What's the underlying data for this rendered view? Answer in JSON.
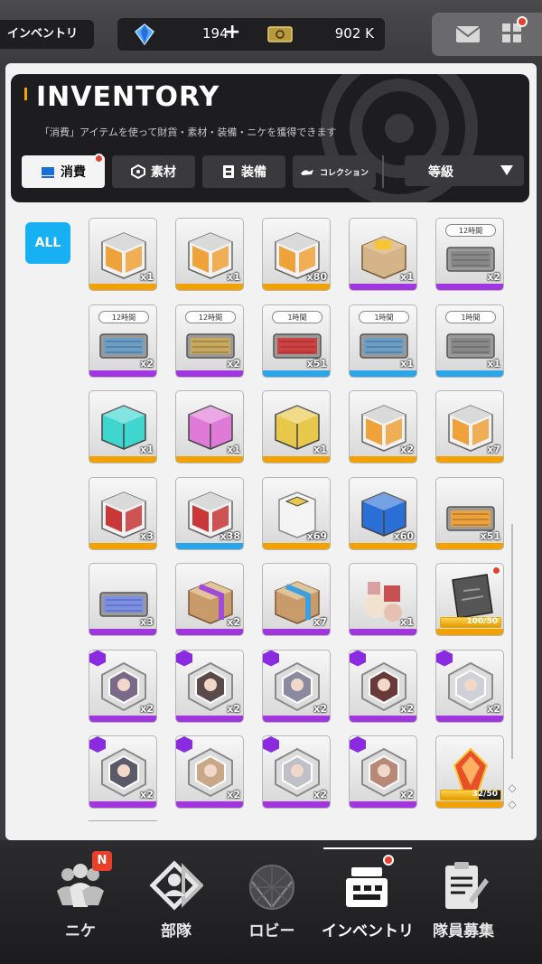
{
  "topbar": {
    "screen_label": "インベントリ",
    "gem_amount": "194",
    "plus": "+",
    "credit_amount": "902 K"
  },
  "header": {
    "title": "INVENTORY",
    "subtitle": "「消費」アイテムを使って財貨・素材・装備・ニケを獲得できます",
    "tabs": [
      {
        "label": "消費",
        "icon": "consumable-icon",
        "active": true
      },
      {
        "label": "素材",
        "icon": "material-icon",
        "active": false
      },
      {
        "label": "装備",
        "icon": "equipment-icon",
        "active": false
      },
      {
        "label": "コレクション",
        "icon": "collection-icon",
        "active": false
      }
    ],
    "sort_label": "等級"
  },
  "filter": {
    "all_label": "ALL"
  },
  "items": [
    {
      "name": "orange-box-item",
      "qty": "x1",
      "rarity": "#f2a200",
      "color": "#f0a23a"
    },
    {
      "name": "orange-box-item",
      "qty": "x1",
      "rarity": "#f2a200",
      "color": "#f0a23a"
    },
    {
      "name": "orange-box-item",
      "qty": "x80",
      "rarity": "#f2a200",
      "color": "#f0a23a"
    },
    {
      "name": "cardboard-box-item",
      "qty": "x1",
      "rarity": "#a335e0",
      "color": "#d6b48a"
    },
    {
      "name": "timed-case-item",
      "qty": "x2",
      "rarity": "#a335e0",
      "color": "#888888",
      "timer": "12時間"
    },
    {
      "name": "timed-case-item",
      "qty": "x2",
      "rarity": "#a335e0",
      "color": "#6aa0c8",
      "timer": "12時間"
    },
    {
      "name": "timed-case-item",
      "qty": "x2",
      "rarity": "#a335e0",
      "color": "#c8a85a",
      "timer": "12時間"
    },
    {
      "name": "timed-case-item",
      "qty": "x51",
      "rarity": "#2aa6e8",
      "color": "#d04040",
      "timer": "1時間"
    },
    {
      "name": "timed-case-item",
      "qty": "x1",
      "rarity": "#2aa6e8",
      "color": "#6aa0c8",
      "timer": "1時間"
    },
    {
      "name": "timed-case-item",
      "qty": "x1",
      "rarity": "#2aa6e8",
      "color": "#888888",
      "timer": "1時間"
    },
    {
      "name": "cyan-crate-item",
      "qty": "x1",
      "rarity": "#f2a200",
      "color": "#3fd6cf"
    },
    {
      "name": "pink-crate-item",
      "qty": "x1",
      "rarity": "#f2a200",
      "color": "#e07ad8"
    },
    {
      "name": "gold-crate-item",
      "qty": "x1",
      "rarity": "#f2a200",
      "color": "#e8c84a"
    },
    {
      "name": "orange-box-item",
      "qty": "x2",
      "rarity": "#f2a200",
      "color": "#f0a23a"
    },
    {
      "name": "orange-box-item",
      "qty": "x7",
      "rarity": "#f2a200",
      "color": "#f0a23a"
    },
    {
      "name": "red-box-item",
      "qty": "x3",
      "rarity": "#f2a200",
      "color": "#c83838"
    },
    {
      "name": "red-box-item",
      "qty": "x38",
      "rarity": "#2aa6e8",
      "color": "#c83838"
    },
    {
      "name": "white-container-item",
      "qty": "x69",
      "rarity": "#f2a200",
      "color": "#e8e8e8"
    },
    {
      "name": "supply-crate-item",
      "qty": "x60",
      "rarity": "#f2a200",
      "color": "#2a6fd6"
    },
    {
      "name": "colorful-case-item",
      "qty": "x51",
      "rarity": "#f2a200",
      "color": "#f0a23a"
    },
    {
      "name": "colorful-case-item",
      "qty": "x3",
      "rarity": "#a335e0",
      "color": "#7a8fe8"
    },
    {
      "name": "purple-package-item",
      "qty": "x2",
      "rarity": "#a335e0",
      "color": "#c99a6a"
    },
    {
      "name": "blue-package-item",
      "qty": "x7",
      "rarity": "#a335e0",
      "color": "#c99a6a"
    },
    {
      "name": "gift-pile-item",
      "qty": "x1",
      "rarity": "#a335e0",
      "color": "#c85050"
    },
    {
      "name": "collection-card-item",
      "qty": "",
      "rarity": "#f2a200",
      "color": "#555555",
      "bar": "100/50",
      "bar_pct": 100,
      "notif": true
    },
    {
      "name": "nikke-token-item",
      "qty": "x2",
      "rarity": "#a335e0",
      "color": "#7a6a8a",
      "badge": "#8a2be2"
    },
    {
      "name": "nikke-token-item",
      "qty": "x2",
      "rarity": "#a335e0",
      "color": "#5a4a4a",
      "badge": "#8a2be2"
    },
    {
      "name": "nikke-token-item",
      "qty": "x2",
      "rarity": "#a335e0",
      "color": "#8a8aa0",
      "badge": "#8a2be2"
    },
    {
      "name": "nikke-token-item",
      "qty": "x2",
      "rarity": "#a335e0",
      "color": "#6a3a3a",
      "badge": "#8a2be2"
    },
    {
      "name": "nikke-token-item",
      "qty": "x2",
      "rarity": "#a335e0",
      "color": "#d0d0d8",
      "badge": "#8a2be2"
    },
    {
      "name": "nikke-token-item",
      "qty": "x2",
      "rarity": "#a335e0",
      "color": "#5a5a6a",
      "badge": "#8a2be2"
    },
    {
      "name": "nikke-token-item",
      "qty": "x2",
      "rarity": "#a335e0",
      "color": "#c8a888",
      "badge": "#8a2be2"
    },
    {
      "name": "nikke-token-item",
      "qty": "x2",
      "rarity": "#a335e0",
      "color": "#c0c0c8",
      "badge": "#8a2be2"
    },
    {
      "name": "nikke-token-item",
      "qty": "x2",
      "rarity": "#a335e0",
      "color": "#b88878",
      "badge": "#8a2be2"
    },
    {
      "name": "core-crystal-item",
      "qty": "",
      "rarity": "#f2a200",
      "color": "#e8502a",
      "bar": "32/50",
      "bar_pct": 64
    }
  ],
  "nav": [
    {
      "label": "ニケ",
      "icon": "nikke-icon",
      "badge": "N"
    },
    {
      "label": "部隊",
      "icon": "squad-icon"
    },
    {
      "label": "ロビー",
      "icon": "lobby-icon"
    },
    {
      "label": "インベントリ",
      "icon": "inventory-icon",
      "active": true
    },
    {
      "label": "隊員募集",
      "icon": "recruit-icon"
    }
  ]
}
